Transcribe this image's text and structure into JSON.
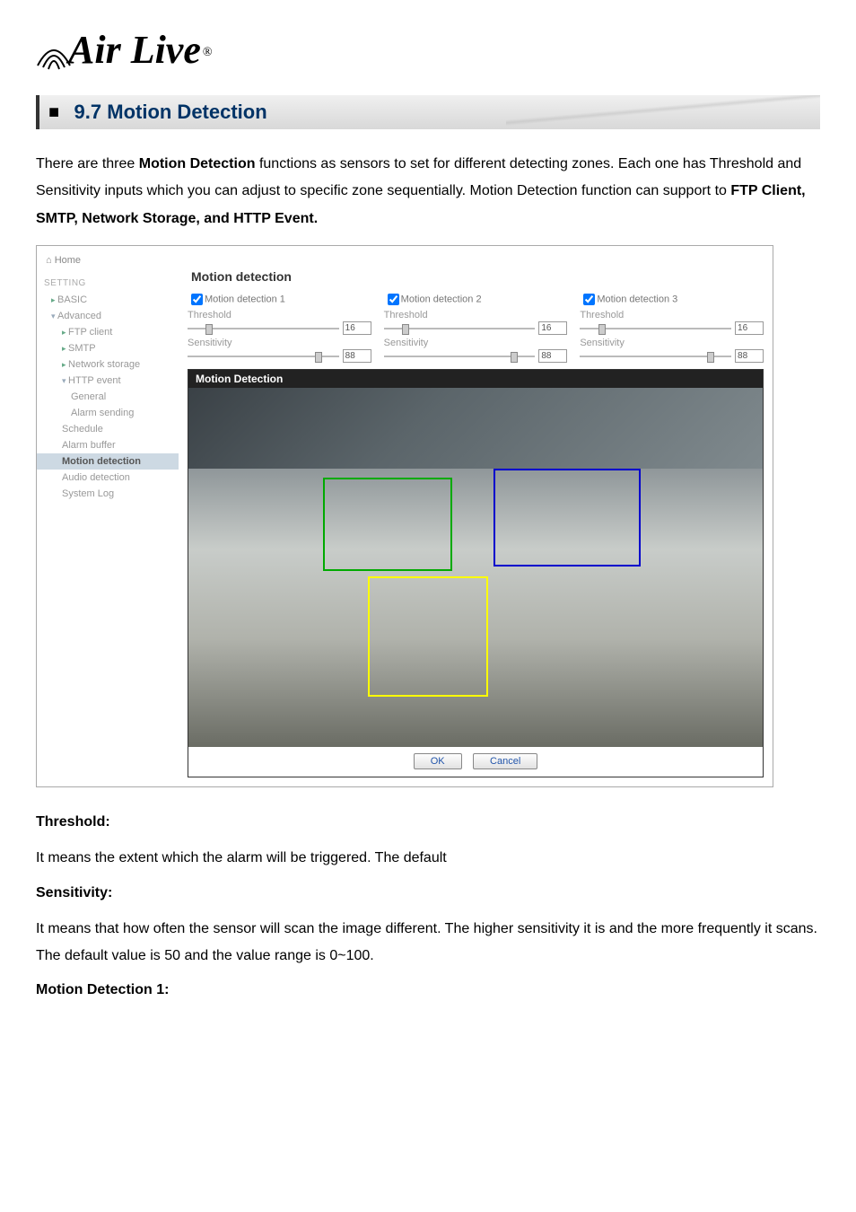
{
  "logo": {
    "text": "Air Live",
    "reg": "®"
  },
  "section": {
    "number_title": "9.7  Motion  Detection"
  },
  "intro": {
    "p1a": "There are three ",
    "p1b": "Motion Detection",
    "p1c": " functions as sensors to set for different detecting zones. Each one has Threshold and Sensitivity inputs which you can adjust to specific zone sequentially. Motion Detection function can support to ",
    "p1d": "FTP Client, SMTP, Network Storage, and HTTP Event."
  },
  "sidebar": {
    "home": "Home",
    "heading": "SETTING",
    "items": [
      {
        "label": "BASIC",
        "cls": "ui-tri-right"
      },
      {
        "label": "Advanced",
        "cls": "ui-tri-down"
      },
      {
        "label": "FTP client",
        "cls": "ui-tri-right sub"
      },
      {
        "label": "SMTP",
        "cls": "ui-tri-right sub"
      },
      {
        "label": "Network storage",
        "cls": "ui-tri-right sub"
      },
      {
        "label": "HTTP event",
        "cls": "ui-tri-down sub"
      },
      {
        "label": "General",
        "cls": "subsub"
      },
      {
        "label": "Alarm sending",
        "cls": "subsub"
      },
      {
        "label": "Schedule",
        "cls": "sub"
      },
      {
        "label": "Alarm buffer",
        "cls": "sub"
      },
      {
        "label": "Motion detection",
        "cls": "sub active"
      },
      {
        "label": "Audio detection",
        "cls": "sub"
      },
      {
        "label": "System Log",
        "cls": "sub"
      }
    ]
  },
  "main": {
    "title": "Motion detection",
    "cols": [
      {
        "chk": "Motion detection 1",
        "thr_label": "Threshold",
        "thr": "16",
        "sen_label": "Sensitivity",
        "sen": "88"
      },
      {
        "chk": "Motion detection 2",
        "thr_label": "Threshold",
        "thr": "16",
        "sen_label": "Sensitivity",
        "sen": "88"
      },
      {
        "chk": "Motion detection 3",
        "thr_label": "Threshold",
        "thr": "16",
        "sen_label": "Sensitivity",
        "sen": "88"
      }
    ],
    "preview_title": "Motion Detection",
    "ok": "OK",
    "cancel": "Cancel"
  },
  "text": {
    "h1": "Threshold:",
    "p1": "It means the extent which the alarm will be triggered. The default",
    "h2": "Sensitivity:",
    "p2": "It means that how often the sensor will scan the image different. The higher sensitivity it is and the more frequently it scans.  The default value is 50 and the value range is 0~100.",
    "h3": "Motion Detection 1:"
  }
}
